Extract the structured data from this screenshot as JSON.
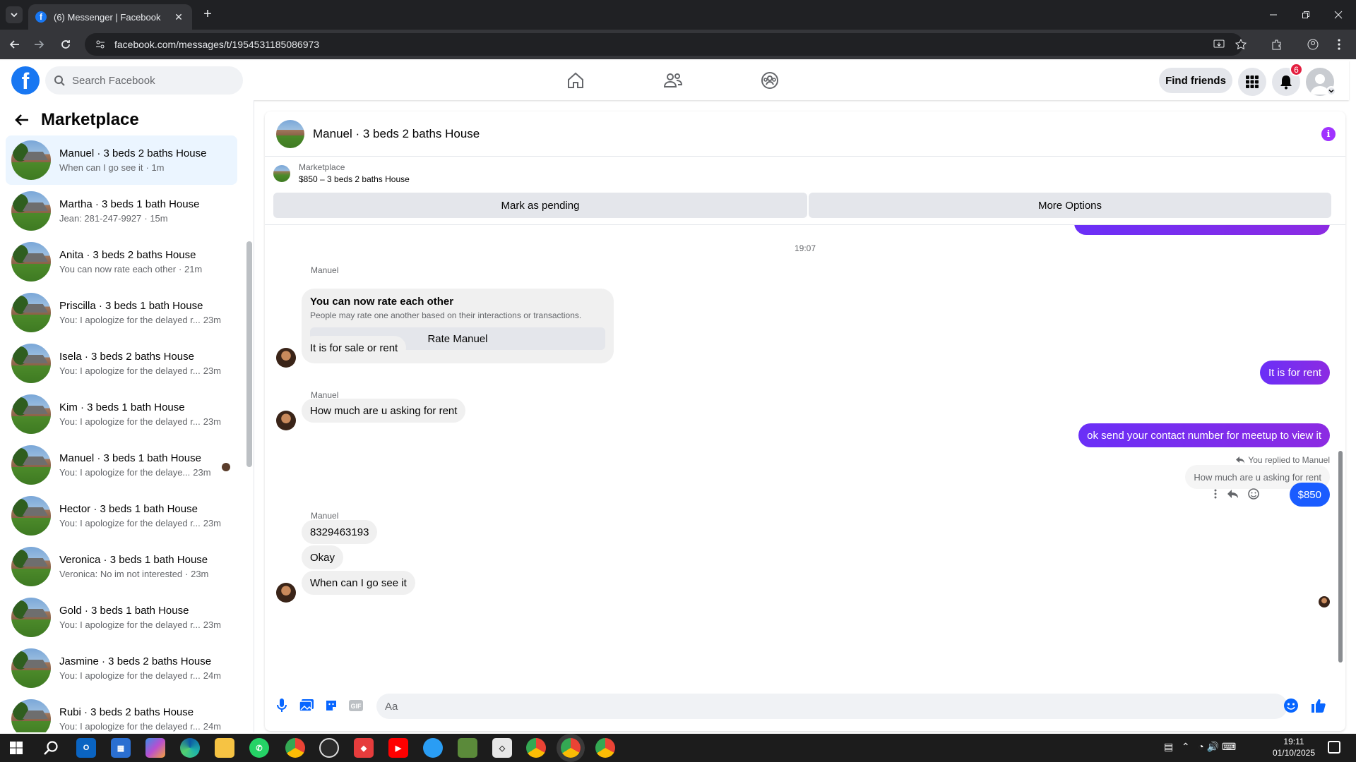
{
  "browser": {
    "tab_title": "(6) Messenger | Facebook",
    "url": "facebook.com/messages/t/1954531185086973"
  },
  "fb": {
    "search_placeholder": "Search Facebook",
    "find_friends": "Find friends",
    "notif_count": "6"
  },
  "sidebar": {
    "title": "Marketplace",
    "conversations": [
      {
        "name": "Manuel · 3 beds 2 baths House",
        "snippet": "When can I go see it",
        "time": "· 1m"
      },
      {
        "name": "Martha · 3 beds 1 bath House",
        "snippet": "Jean: 281-247-9927",
        "time": "· 15m"
      },
      {
        "name": "Anita · 3 beds 2 baths House",
        "snippet": "You can now rate each other",
        "time": "· 21m"
      },
      {
        "name": "Priscilla · 3 beds 1 bath House",
        "snippet": "You: I apologize for the delayed r...",
        "time": "23m"
      },
      {
        "name": "Isela · 3 beds 2 baths House",
        "snippet": "You: I apologize for the delayed r...",
        "time": "23m"
      },
      {
        "name": "Kim · 3 beds 1 bath House",
        "snippet": "You: I apologize for the delayed r...",
        "time": "23m"
      },
      {
        "name": "Manuel · 3 beds 1 bath House",
        "snippet": "You: I apologize for the delaye...",
        "time": "23m"
      },
      {
        "name": "Hector · 3 beds 1 bath House",
        "snippet": "You: I apologize for the delayed r...",
        "time": "23m"
      },
      {
        "name": "Veronica · 3 beds 1 bath House",
        "snippet": "Veronica: No im not interested",
        "time": "· 23m"
      },
      {
        "name": "Gold · 3 beds 1 bath House",
        "snippet": "You: I apologize for the delayed r...",
        "time": "23m"
      },
      {
        "name": "Jasmine · 3 beds 2 baths House",
        "snippet": "You: I apologize for the delayed r...",
        "time": "24m"
      },
      {
        "name": "Rubi · 3 beds 2 baths House",
        "snippet": "You: I apologize for the delayed r...",
        "time": "24m"
      }
    ]
  },
  "chat": {
    "title": "Manuel · 3 beds 2 baths House",
    "listing_label": "Marketplace",
    "listing_desc": "$850 – 3 beds 2 baths House",
    "mark_pending": "Mark as pending",
    "more_options": "More Options",
    "timestamp": "19:07",
    "sender_name": "Manuel",
    "rate_title": "You can now rate each other",
    "rate_sub": "People may rate one another based on their interactions or transactions.",
    "rate_button": "Rate Manuel",
    "msg1": "It is for sale or rent",
    "msg2": "It is for rent",
    "msg3": "How much are u asking for rent",
    "msg4": "ok send your contact number for meetup to view it",
    "reply_label": "You replied to Manuel",
    "reply_quote": "How much are u asking for rent",
    "msg5": "$850",
    "msg6": "8329463193",
    "msg7": "Okay",
    "msg8": "When can I go see it",
    "input_placeholder": "Aa"
  },
  "taskbar": {
    "time": "19:11",
    "date": "01/10/2025"
  }
}
